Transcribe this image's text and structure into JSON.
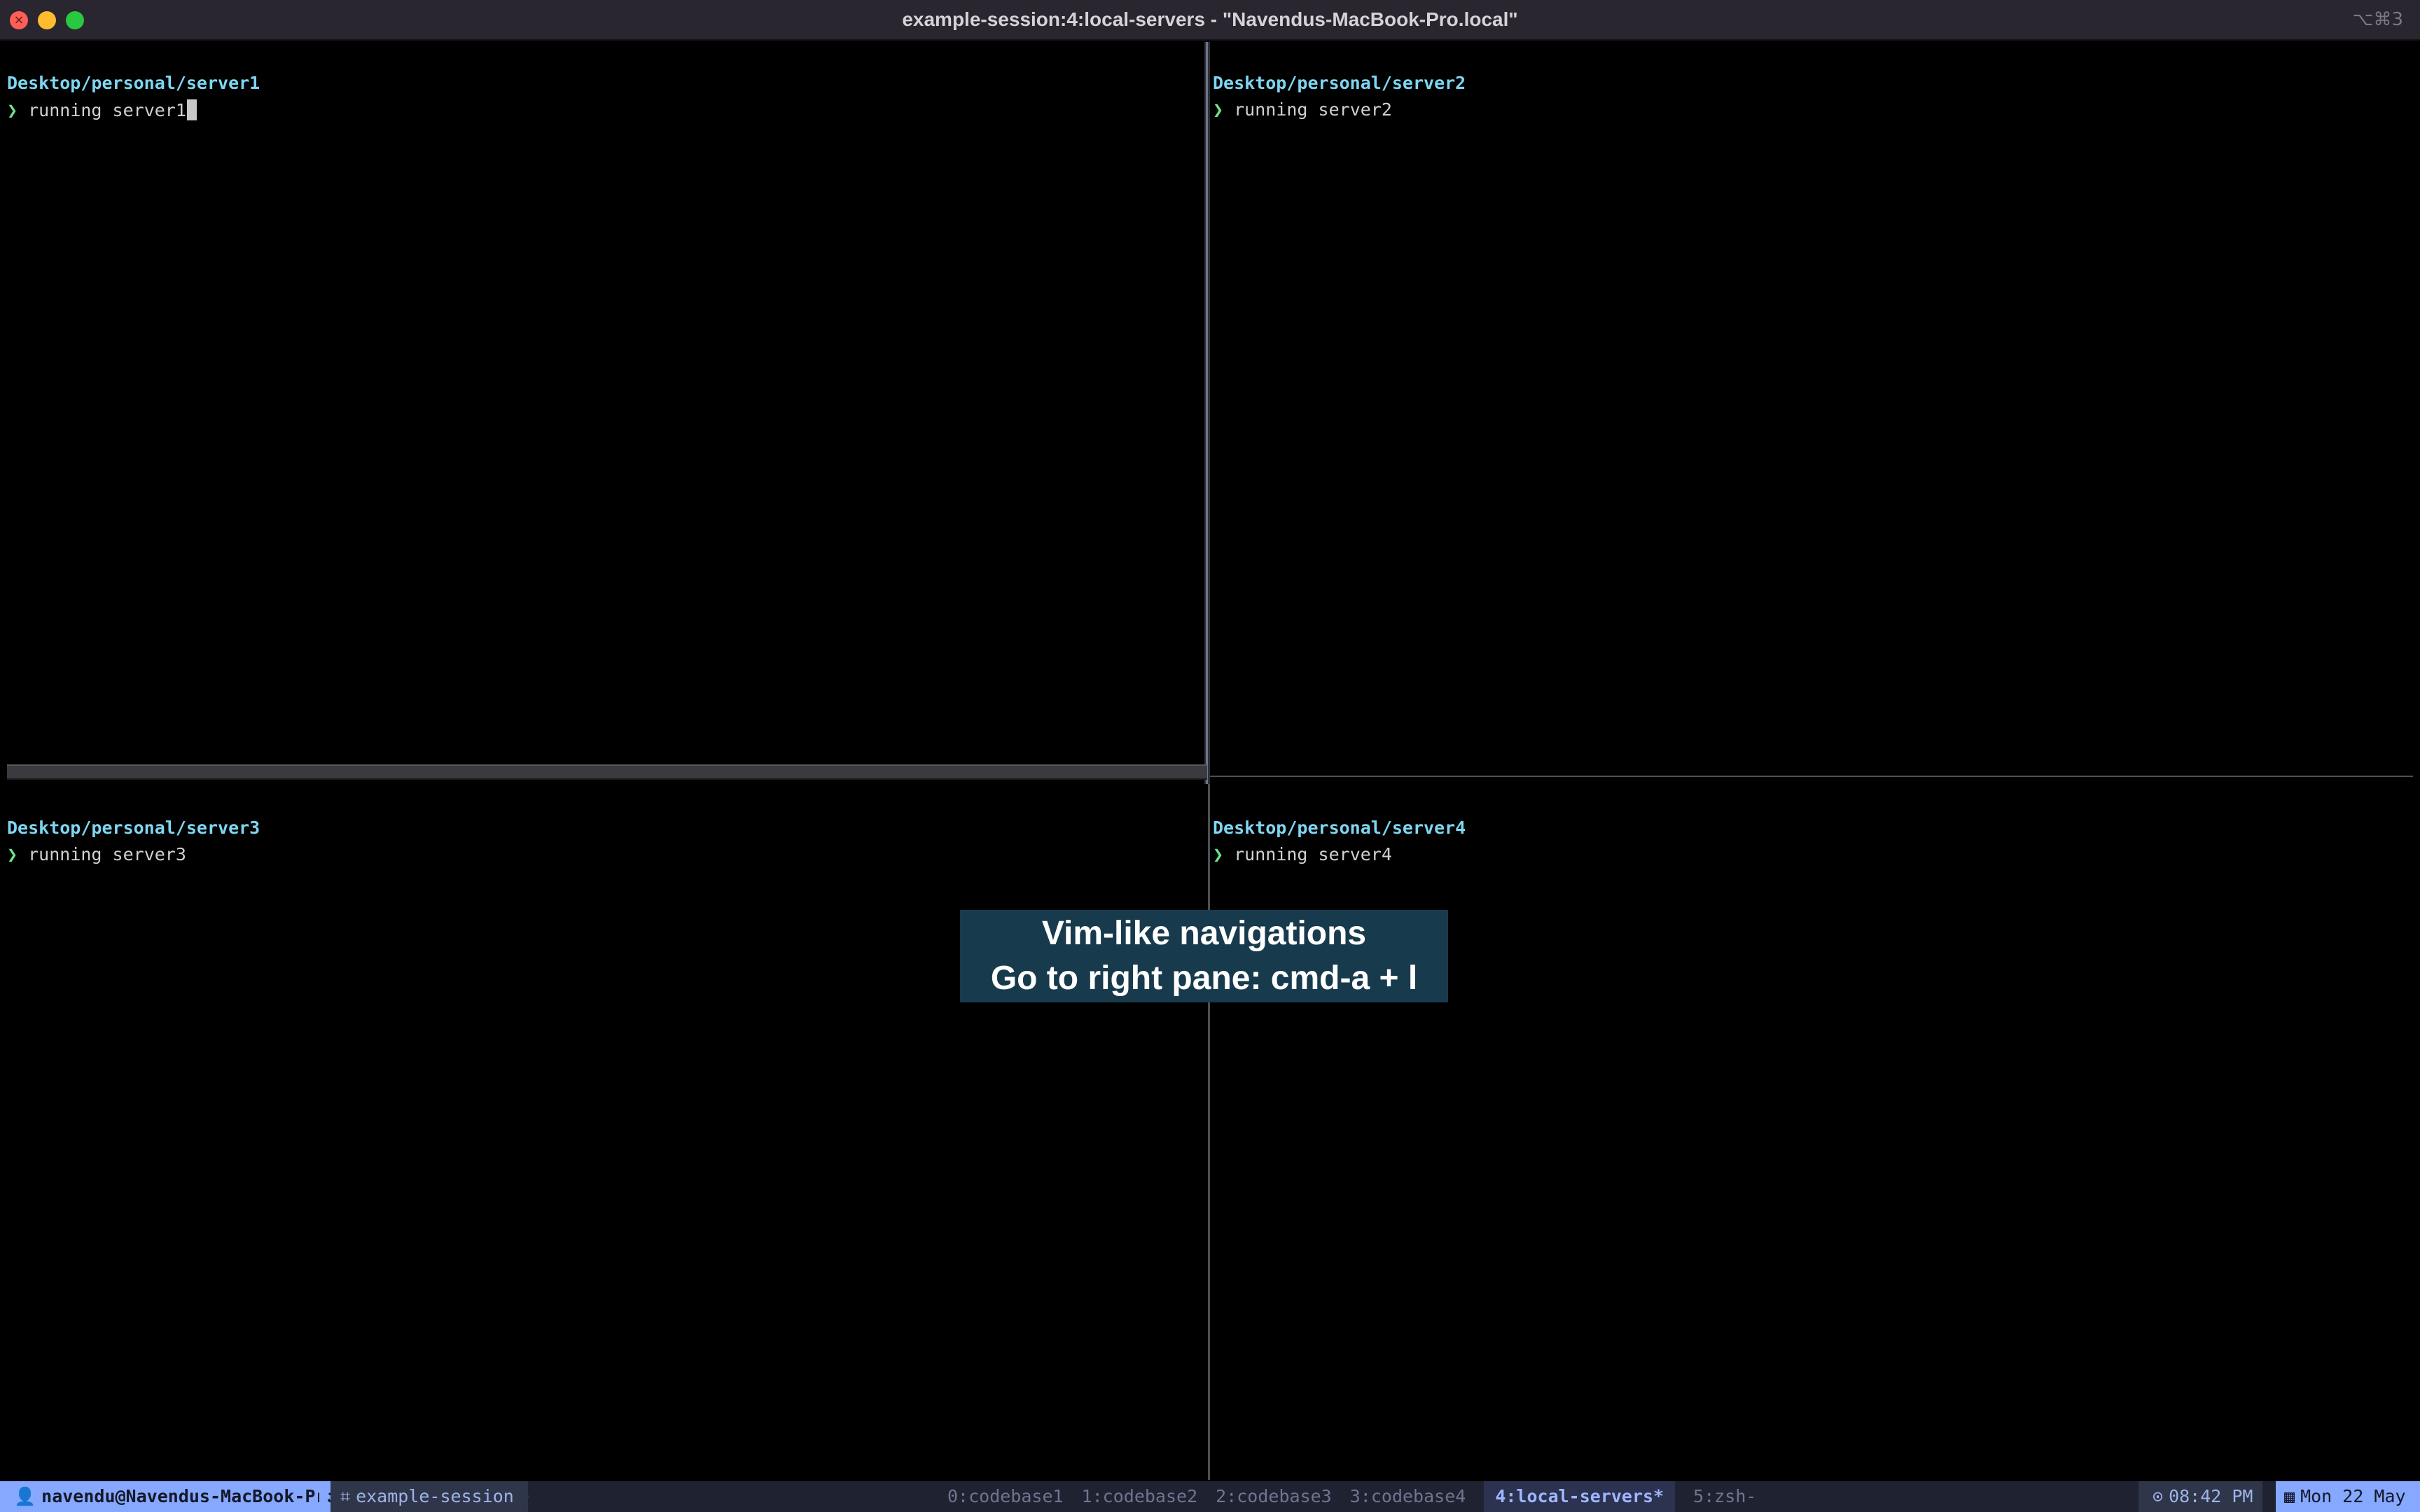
{
  "window": {
    "title": "example-session:4:local-servers - \"Navendus-MacBook-Pro.local\"",
    "shortcut": "⌥⌘3",
    "close_glyph": "×"
  },
  "panes": [
    {
      "path": "Desktop/personal/server1",
      "prompt": "❯",
      "command": "running server1",
      "active": true
    },
    {
      "path": "Desktop/personal/server2",
      "prompt": "❯",
      "command": "running server2",
      "active": false
    },
    {
      "path": "Desktop/personal/server3",
      "prompt": "❯",
      "command": "running server3",
      "active": false
    },
    {
      "path": "Desktop/personal/server4",
      "prompt": "❯",
      "command": "running server4",
      "active": false
    }
  ],
  "overlay": {
    "line1": "Vim-like navigations",
    "line2": "Go to right pane: cmd-a + l"
  },
  "statusbar": {
    "user_icon": "👤",
    "user": "navendu@Navendus-MacBook-Pro",
    "session_icon": "⌗",
    "session": "example-session",
    "windows": [
      {
        "label": "0:codebase1",
        "active": false
      },
      {
        "label": "1:codebase2",
        "active": false
      },
      {
        "label": "2:codebase3",
        "active": false
      },
      {
        "label": "3:codebase4",
        "active": false
      },
      {
        "label": "4:local-servers*",
        "active": true
      },
      {
        "label": "5:zsh-",
        "active": false
      }
    ],
    "time_icon": "⊙",
    "time": "08:42 PM",
    "date_icon": "▦",
    "date": "Mon 22 May"
  },
  "colors": {
    "path": "#7fd6f2",
    "prompt": "#6ee38b",
    "overlay_bg": "#183a4d",
    "status_accent": "#86a8ff"
  }
}
